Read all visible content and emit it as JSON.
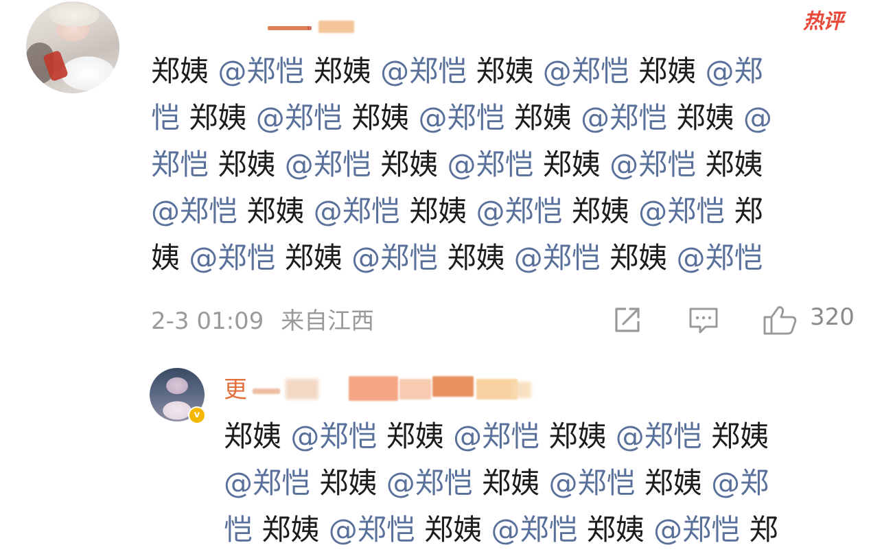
{
  "comment": {
    "badge": "热评",
    "lines": [
      [
        {
          "t": "郑姨",
          "m": false
        },
        {
          "t": " @郑恺 ",
          "m": true
        },
        {
          "t": "郑姨",
          "m": false
        },
        {
          "t": " @郑恺 ",
          "m": true
        },
        {
          "t": "郑姨",
          "m": false
        },
        {
          "t": " @郑恺 ",
          "m": true
        },
        {
          "t": "郑姨",
          "m": false
        },
        {
          "t": " @郑",
          "m": true
        }
      ],
      [
        {
          "t": "恺 ",
          "m": true
        },
        {
          "t": "郑姨",
          "m": false
        },
        {
          "t": " @郑恺 ",
          "m": true
        },
        {
          "t": "郑姨",
          "m": false
        },
        {
          "t": " @郑恺 ",
          "m": true
        },
        {
          "t": "郑姨",
          "m": false
        },
        {
          "t": " @郑恺 ",
          "m": true
        },
        {
          "t": "郑姨",
          "m": false
        },
        {
          "t": " @",
          "m": true
        }
      ],
      [
        {
          "t": "郑恺 ",
          "m": true
        },
        {
          "t": "郑姨",
          "m": false
        },
        {
          "t": " @郑恺 ",
          "m": true
        },
        {
          "t": "郑姨",
          "m": false
        },
        {
          "t": " @郑恺 ",
          "m": true
        },
        {
          "t": "郑姨",
          "m": false
        },
        {
          "t": " @郑恺 ",
          "m": true
        },
        {
          "t": "郑姨",
          "m": false
        }
      ],
      [
        {
          "t": "@郑恺 ",
          "m": true
        },
        {
          "t": "郑姨",
          "m": false
        },
        {
          "t": " @郑恺 ",
          "m": true
        },
        {
          "t": "郑姨",
          "m": false
        },
        {
          "t": " @郑恺 ",
          "m": true
        },
        {
          "t": "郑姨",
          "m": false
        },
        {
          "t": " @郑恺 ",
          "m": true
        },
        {
          "t": "郑",
          "m": false
        }
      ],
      [
        {
          "t": "姨",
          "m": false
        },
        {
          "t": " @郑恺 ",
          "m": true
        },
        {
          "t": "郑姨",
          "m": false
        },
        {
          "t": " @郑恺 ",
          "m": true
        },
        {
          "t": "郑姨",
          "m": false
        },
        {
          "t": " @郑恺 ",
          "m": true
        },
        {
          "t": "郑姨",
          "m": false
        },
        {
          "t": " @郑恺",
          "m": true
        }
      ]
    ],
    "timestamp": "2-3 01:09",
    "location": "来自江西",
    "like_count": "320"
  },
  "reply": {
    "name_visible": "更",
    "lines": [
      [
        {
          "t": "郑姨",
          "m": false
        },
        {
          "t": " @郑恺 ",
          "m": true
        },
        {
          "t": "郑姨",
          "m": false
        },
        {
          "t": " @郑恺 ",
          "m": true
        },
        {
          "t": "郑姨",
          "m": false
        },
        {
          "t": " @郑恺 ",
          "m": true
        },
        {
          "t": "郑姨",
          "m": false
        }
      ],
      [
        {
          "t": "@郑恺 ",
          "m": true
        },
        {
          "t": "郑姨",
          "m": false
        },
        {
          "t": " @郑恺 ",
          "m": true
        },
        {
          "t": "郑姨",
          "m": false
        },
        {
          "t": " @郑恺 ",
          "m": true
        },
        {
          "t": "郑姨",
          "m": false
        },
        {
          "t": " @郑",
          "m": true
        }
      ],
      [
        {
          "t": "恺 ",
          "m": true
        },
        {
          "t": "郑姨",
          "m": false
        },
        {
          "t": " @郑恺 ",
          "m": true
        },
        {
          "t": "郑姨",
          "m": false
        },
        {
          "t": " @郑恺 ",
          "m": true
        },
        {
          "t": "郑姨",
          "m": false
        },
        {
          "t": " @郑恺 ",
          "m": true
        },
        {
          "t": "郑",
          "m": false
        }
      ]
    ]
  },
  "colors": {
    "mention": "#59709a",
    "text": "#1c1c1c",
    "meta": "#9a9a9a",
    "hot": "#e8493a",
    "verified": "#f5b800"
  },
  "icons": {
    "share": "share-icon",
    "comment": "comment-icon",
    "like": "thumbs-up-icon"
  }
}
